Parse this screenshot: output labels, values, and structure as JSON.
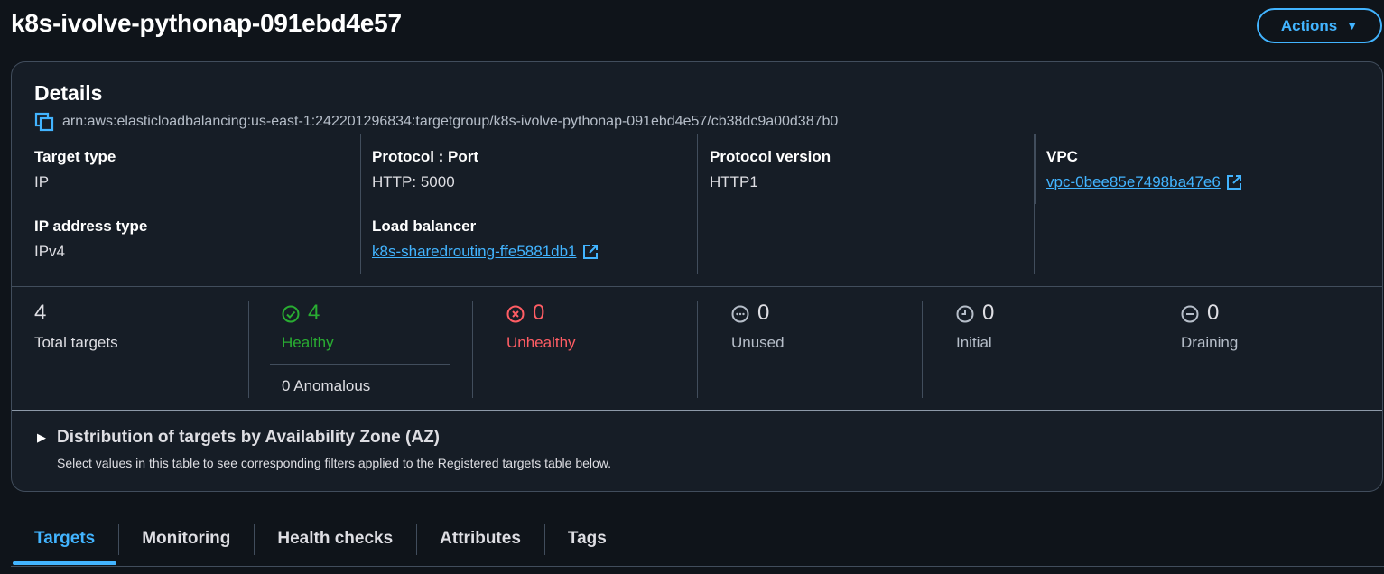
{
  "header": {
    "title": "k8s-ivolve-pythonap-091ebd4e57",
    "actions_label": "Actions"
  },
  "details": {
    "heading": "Details",
    "arn": "arn:aws:elasticloadbalancing:us-east-1:242201296834:targetgroup/k8s-ivolve-pythonap-091ebd4e57/cb38dc9a00d387b0",
    "target_type": {
      "label": "Target type",
      "value": "IP"
    },
    "ip_address_type": {
      "label": "IP address type",
      "value": "IPv4"
    },
    "protocol_port": {
      "label": "Protocol : Port",
      "value": "HTTP: 5000"
    },
    "load_balancer": {
      "label": "Load balancer",
      "value": "k8s-sharedrouting-ffe5881db1"
    },
    "protocol_version": {
      "label": "Protocol version",
      "value": "HTTP1"
    },
    "vpc": {
      "label": "VPC",
      "value": "vpc-0bee85e7498ba47e6"
    }
  },
  "stats": {
    "total": {
      "value": "4",
      "label": "Total targets"
    },
    "healthy": {
      "value": "4",
      "label": "Healthy",
      "anomalous": "0 Anomalous"
    },
    "unhealthy": {
      "value": "0",
      "label": "Unhealthy"
    },
    "unused": {
      "value": "0",
      "label": "Unused"
    },
    "initial": {
      "value": "0",
      "label": "Initial"
    },
    "draining": {
      "value": "0",
      "label": "Draining"
    }
  },
  "distribution": {
    "title": "Distribution of targets by Availability Zone (AZ)",
    "description": "Select values in this table to see corresponding filters applied to the Registered targets table below."
  },
  "tabs": [
    {
      "label": "Targets",
      "active": true
    },
    {
      "label": "Monitoring"
    },
    {
      "label": "Health checks"
    },
    {
      "label": "Attributes"
    },
    {
      "label": "Tags"
    }
  ],
  "colors": {
    "accent": "#42b4ff",
    "healthy": "#29ad32",
    "unhealthy": "#ff5d64",
    "background": "#0f141a",
    "panel": "#161d26"
  }
}
